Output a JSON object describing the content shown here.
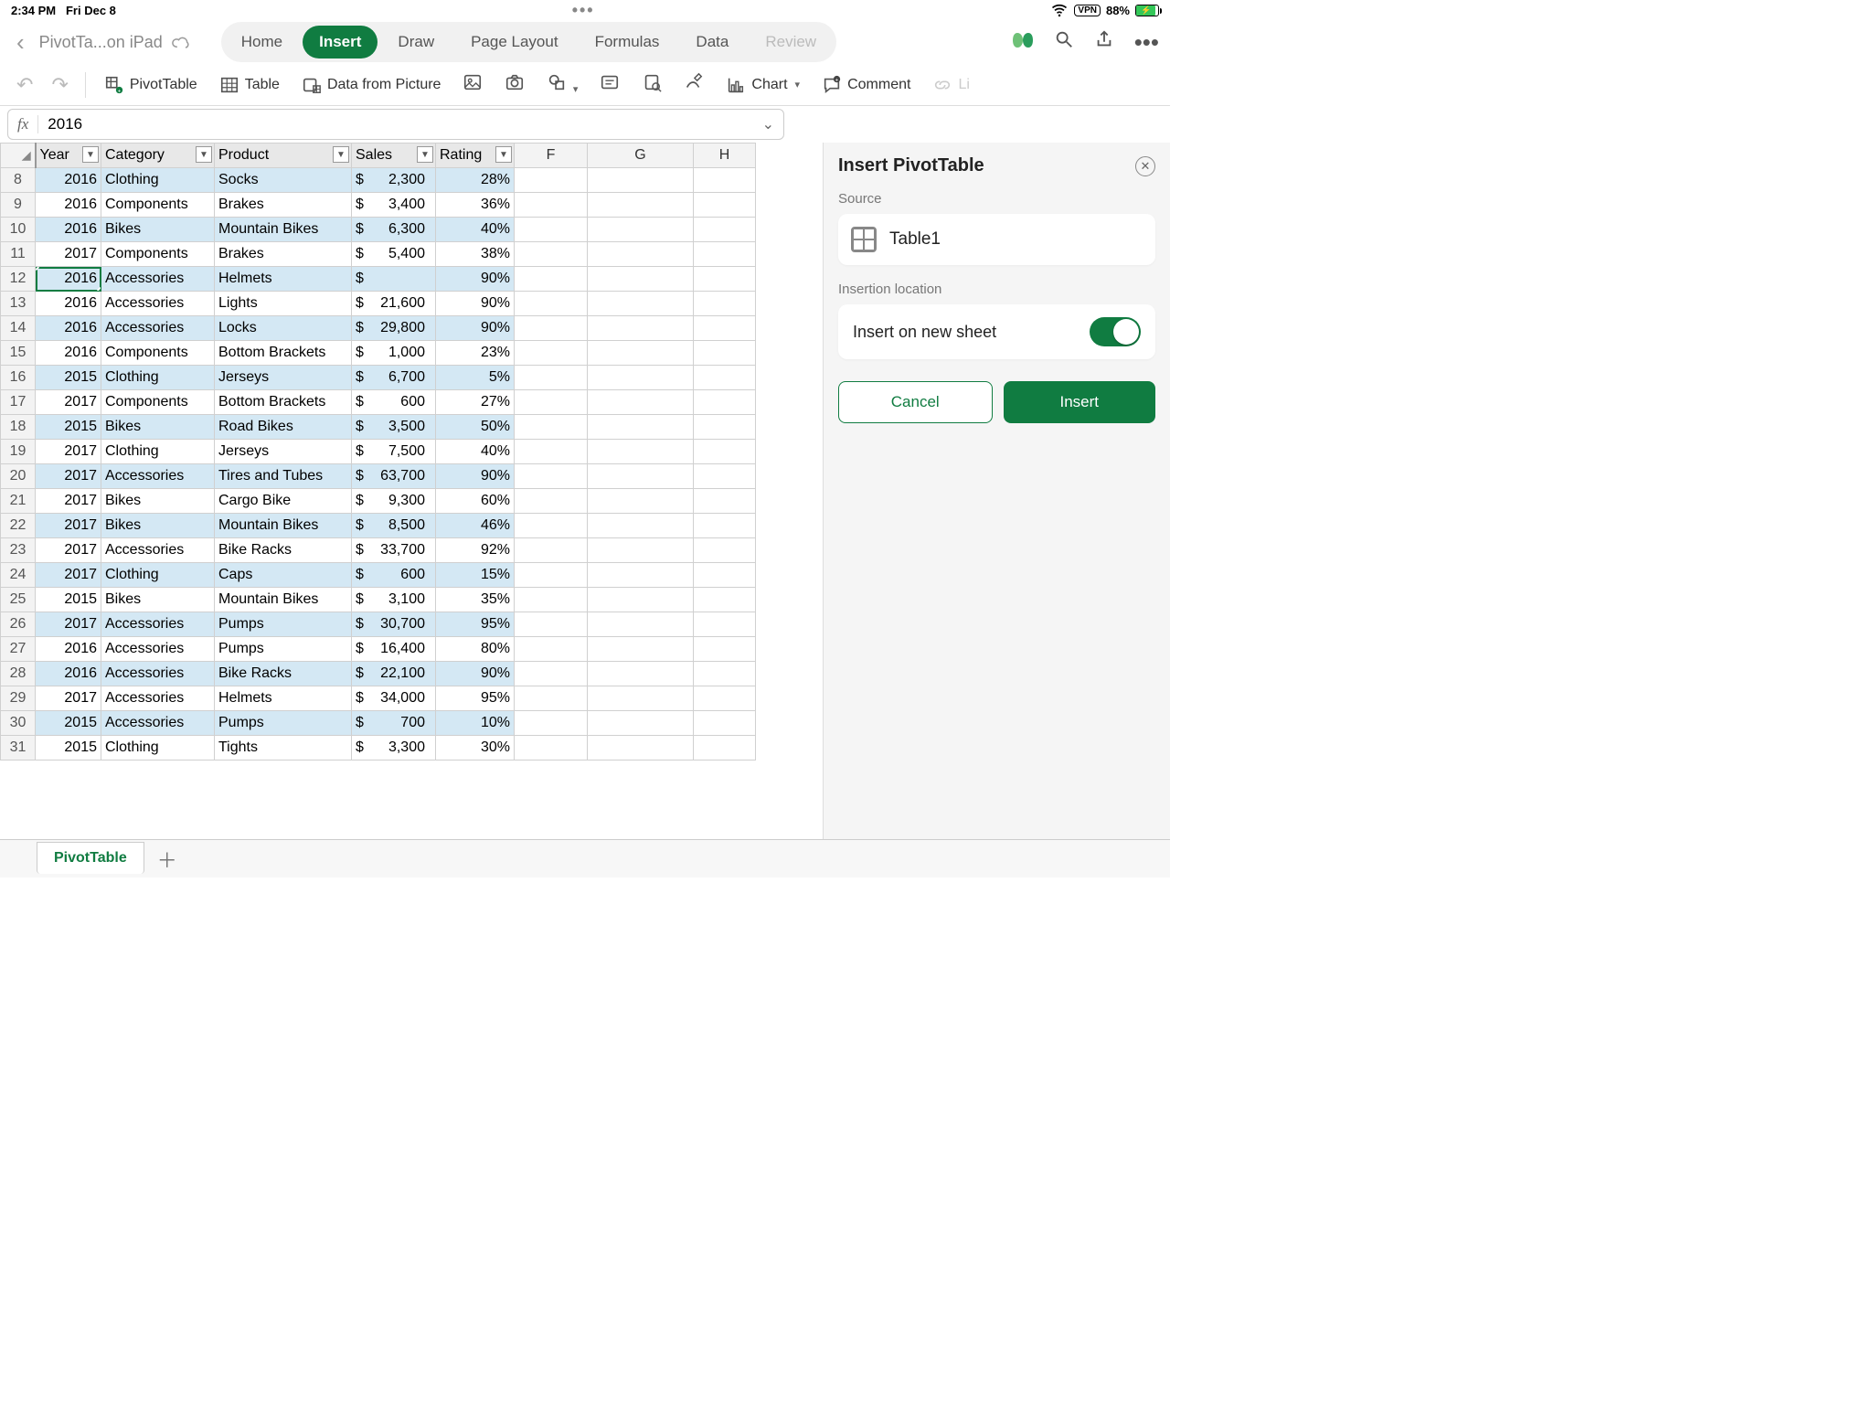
{
  "status_bar": {
    "time": "2:34 PM",
    "date": "Fri Dec 8",
    "vpn": "VPN",
    "battery_pct": "88%"
  },
  "header": {
    "doc_title": "PivotTa...on iPad",
    "tabs": [
      "Home",
      "Insert",
      "Draw",
      "Page Layout",
      "Formulas",
      "Data",
      "Review"
    ],
    "active_tab": "Insert"
  },
  "toolbar": {
    "pivot_table": "PivotTable",
    "table": "Table",
    "data_from_picture": "Data from Picture",
    "chart": "Chart",
    "comment": "Comment",
    "link": "Li"
  },
  "formula": {
    "fx": "fx",
    "value": "2016"
  },
  "columns": {
    "headers": [
      "Year",
      "Category",
      "Product",
      "Sales",
      "Rating"
    ],
    "extras": [
      "F",
      "G",
      "H"
    ]
  },
  "rows": [
    {
      "n": 8,
      "year": 2016,
      "category": "Clothing",
      "product": "Socks",
      "sales": "2,300",
      "rating": "28%"
    },
    {
      "n": 9,
      "year": 2016,
      "category": "Components",
      "product": "Brakes",
      "sales": "3,400",
      "rating": "36%"
    },
    {
      "n": 10,
      "year": 2016,
      "category": "Bikes",
      "product": "Mountain Bikes",
      "sales": "6,300",
      "rating": "40%"
    },
    {
      "n": 11,
      "year": 2017,
      "category": "Components",
      "product": "Brakes",
      "sales": "5,400",
      "rating": "38%"
    },
    {
      "n": 12,
      "year": 2016,
      "category": "Accessories",
      "product": "Helmets",
      "sales": "",
      "rating": "90%"
    },
    {
      "n": 13,
      "year": 2016,
      "category": "Accessories",
      "product": "Lights",
      "sales": "21,600",
      "rating": "90%"
    },
    {
      "n": 14,
      "year": 2016,
      "category": "Accessories",
      "product": "Locks",
      "sales": "29,800",
      "rating": "90%"
    },
    {
      "n": 15,
      "year": 2016,
      "category": "Components",
      "product": "Bottom Brackets",
      "sales": "1,000",
      "rating": "23%"
    },
    {
      "n": 16,
      "year": 2015,
      "category": "Clothing",
      "product": "Jerseys",
      "sales": "6,700",
      "rating": "5%"
    },
    {
      "n": 17,
      "year": 2017,
      "category": "Components",
      "product": "Bottom Brackets",
      "sales": "600",
      "rating": "27%"
    },
    {
      "n": 18,
      "year": 2015,
      "category": "Bikes",
      "product": "Road Bikes",
      "sales": "3,500",
      "rating": "50%"
    },
    {
      "n": 19,
      "year": 2017,
      "category": "Clothing",
      "product": "Jerseys",
      "sales": "7,500",
      "rating": "40%"
    },
    {
      "n": 20,
      "year": 2017,
      "category": "Accessories",
      "product": "Tires and Tubes",
      "sales": "63,700",
      "rating": "90%"
    },
    {
      "n": 21,
      "year": 2017,
      "category": "Bikes",
      "product": "Cargo Bike",
      "sales": "9,300",
      "rating": "60%"
    },
    {
      "n": 22,
      "year": 2017,
      "category": "Bikes",
      "product": "Mountain Bikes",
      "sales": "8,500",
      "rating": "46%"
    },
    {
      "n": 23,
      "year": 2017,
      "category": "Accessories",
      "product": "Bike Racks",
      "sales": "33,700",
      "rating": "92%"
    },
    {
      "n": 24,
      "year": 2017,
      "category": "Clothing",
      "product": "Caps",
      "sales": "600",
      "rating": "15%"
    },
    {
      "n": 25,
      "year": 2015,
      "category": "Bikes",
      "product": "Mountain Bikes",
      "sales": "3,100",
      "rating": "35%"
    },
    {
      "n": 26,
      "year": 2017,
      "category": "Accessories",
      "product": "Pumps",
      "sales": "30,700",
      "rating": "95%"
    },
    {
      "n": 27,
      "year": 2016,
      "category": "Accessories",
      "product": "Pumps",
      "sales": "16,400",
      "rating": "80%"
    },
    {
      "n": 28,
      "year": 2016,
      "category": "Accessories",
      "product": "Bike Racks",
      "sales": "22,100",
      "rating": "90%"
    },
    {
      "n": 29,
      "year": 2017,
      "category": "Accessories",
      "product": "Helmets",
      "sales": "34,000",
      "rating": "95%"
    },
    {
      "n": 30,
      "year": 2015,
      "category": "Accessories",
      "product": "Pumps",
      "sales": "700",
      "rating": "10%"
    },
    {
      "n": 31,
      "year": 2015,
      "category": "Clothing",
      "product": "Tights",
      "sales": "3,300",
      "rating": "30%"
    }
  ],
  "selected_row": 12,
  "side_panel": {
    "title": "Insert PivotTable",
    "source_label": "Source",
    "source_name": "Table1",
    "location_label": "Insertion location",
    "insert_new_sheet": "Insert on new sheet",
    "toggle_on": true,
    "cancel": "Cancel",
    "insert": "Insert"
  },
  "sheet_tabs": {
    "active": "PivotTable"
  }
}
